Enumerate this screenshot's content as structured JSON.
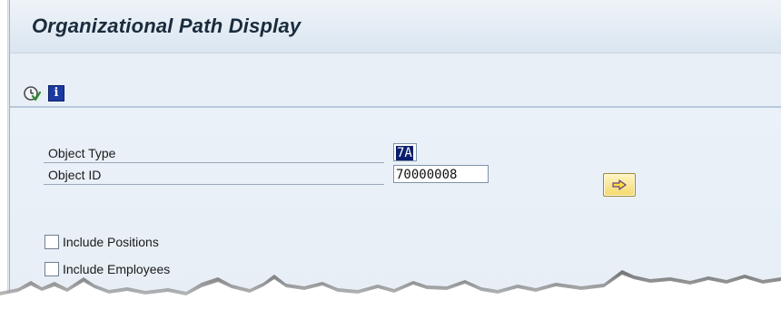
{
  "header": {
    "title": "Organizational Path Display"
  },
  "toolbar": {
    "buttons": [
      {
        "name": "execute",
        "icon": "clock-execute-icon"
      },
      {
        "name": "information",
        "icon": "info-icon",
        "glyph": "i"
      }
    ]
  },
  "form": {
    "object_type": {
      "label": "Object Type",
      "value": "7A"
    },
    "object_id": {
      "label": "Object ID",
      "value": "70000008"
    },
    "go_button_icon": "arrow-right-icon"
  },
  "options": [
    {
      "label": "Include Positions",
      "checked": false
    },
    {
      "label": "Include Employees",
      "checked": false
    }
  ],
  "colors": {
    "title_bg": "#dbe6f1",
    "selection": "#0a1f6e",
    "go_button": "#f4d96a",
    "info_icon": "#1c3aa0"
  }
}
